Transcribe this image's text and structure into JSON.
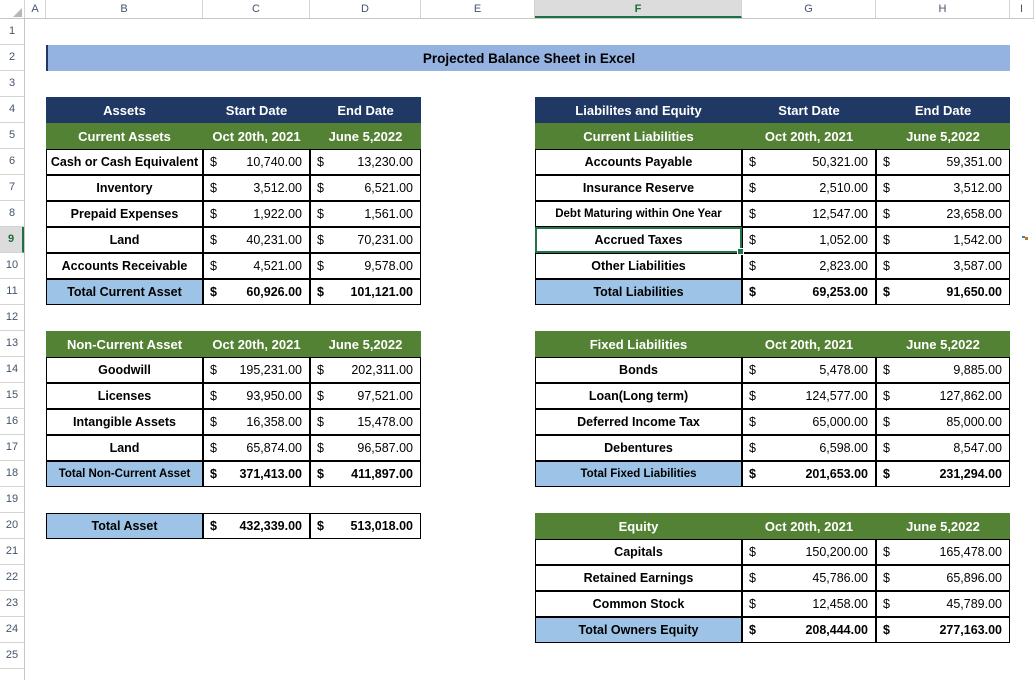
{
  "app": {
    "type": "spreadsheet",
    "columns": [
      "A",
      "B",
      "C",
      "D",
      "E",
      "F",
      "G",
      "H",
      "I"
    ],
    "selected_column": "F",
    "rows": [
      "1",
      "2",
      "3",
      "4",
      "5",
      "6",
      "7",
      "8",
      "9",
      "10",
      "11",
      "12",
      "13",
      "14",
      "15",
      "16",
      "17",
      "18",
      "19",
      "20",
      "21",
      "22",
      "23",
      "24",
      "25"
    ],
    "selected_row": "9",
    "active_cell": "F9"
  },
  "colors": {
    "navy_header": "#1F3864",
    "green_header": "#548235",
    "blue_total": "#9DC3E6",
    "banner": "#95B3E0",
    "selection_green": "#217346"
  },
  "banner": {
    "title": "Projected Balance Sheet in Excel"
  },
  "left": {
    "current_assets": {
      "title_row": [
        "Assets",
        "Start Date",
        "End Date"
      ],
      "subtitle_row": [
        "Current Assets",
        "Oct 20th, 2021",
        "June 5,2022"
      ],
      "rows": [
        {
          "label": "Cash or Cash Equivalent",
          "start": "10,740.00",
          "end": "13,230.00"
        },
        {
          "label": "Inventory",
          "start": "3,512.00",
          "end": "6,521.00"
        },
        {
          "label": "Prepaid Expenses",
          "start": "1,922.00",
          "end": "1,561.00"
        },
        {
          "label": "Land",
          "start": "40,231.00",
          "end": "70,231.00"
        },
        {
          "label": "Accounts Receivable",
          "start": "4,521.00",
          "end": "9,578.00"
        }
      ],
      "total": {
        "label": "Total Current Asset",
        "start": "60,926.00",
        "end": "101,121.00"
      }
    },
    "non_current_assets": {
      "title_row": [
        "Non-Current Asset",
        "Oct 20th, 2021",
        "June 5,2022"
      ],
      "rows": [
        {
          "label": "Goodwill",
          "start": "195,231.00",
          "end": "202,311.00"
        },
        {
          "label": "Licenses",
          "start": "93,950.00",
          "end": "97,521.00"
        },
        {
          "label": "Intangible Assets",
          "start": "16,358.00",
          "end": "15,478.00"
        },
        {
          "label": "Land",
          "start": "65,874.00",
          "end": "96,587.00"
        }
      ],
      "total": {
        "label": "Total Non-Current Asset",
        "start": "371,413.00",
        "end": "411,897.00"
      }
    },
    "total_asset": {
      "label": "Total Asset",
      "start": "432,339.00",
      "end": "513,018.00"
    }
  },
  "right": {
    "current_liabilities": {
      "title_row": [
        "Liabilites and Equity",
        "Start Date",
        "End Date"
      ],
      "subtitle_row": [
        "Current Liabilities",
        "Oct 20th, 2021",
        "June 5,2022"
      ],
      "rows": [
        {
          "label": "Accounts Payable",
          "start": "50,321.00",
          "end": "59,351.00"
        },
        {
          "label": "Insurance Reserve",
          "start": "2,510.00",
          "end": "3,512.00"
        },
        {
          "label": "Debt Maturing within One Year",
          "start": "12,547.00",
          "end": "23,658.00"
        },
        {
          "label": "Accrued Taxes",
          "start": "1,052.00",
          "end": "1,542.00"
        },
        {
          "label": "Other Liabilities",
          "start": "2,823.00",
          "end": "3,587.00"
        }
      ],
      "total": {
        "label": "Total Liabilities",
        "start": "69,253.00",
        "end": "91,650.00"
      }
    },
    "fixed_liabilities": {
      "title_row": [
        "Fixed Liabilities",
        "Oct 20th, 2021",
        "June 5,2022"
      ],
      "rows": [
        {
          "label": "Bonds",
          "start": "5,478.00",
          "end": "9,885.00"
        },
        {
          "label": "Loan(Long term)",
          "start": "124,577.00",
          "end": "127,862.00"
        },
        {
          "label": "Deferred Income Tax",
          "start": "65,000.00",
          "end": "85,000.00"
        },
        {
          "label": "Debentures",
          "start": "6,598.00",
          "end": "8,547.00"
        }
      ],
      "total": {
        "label": "Total Fixed Liabilities",
        "start": "201,653.00",
        "end": "231,294.00"
      }
    },
    "equity": {
      "title_row": [
        "Equity",
        "Oct 20th, 2021",
        "June 5,2022"
      ],
      "rows": [
        {
          "label": "Capitals",
          "start": "150,200.00",
          "end": "165,478.00"
        },
        {
          "label": "Retained Earnings",
          "start": "45,786.00",
          "end": "65,896.00"
        },
        {
          "label": "Common Stock",
          "start": "12,458.00",
          "end": "45,789.00"
        }
      ],
      "total": {
        "label": "Total Owners Equity",
        "start": "208,444.00",
        "end": "277,163.00"
      }
    }
  },
  "currency_symbol": "$"
}
